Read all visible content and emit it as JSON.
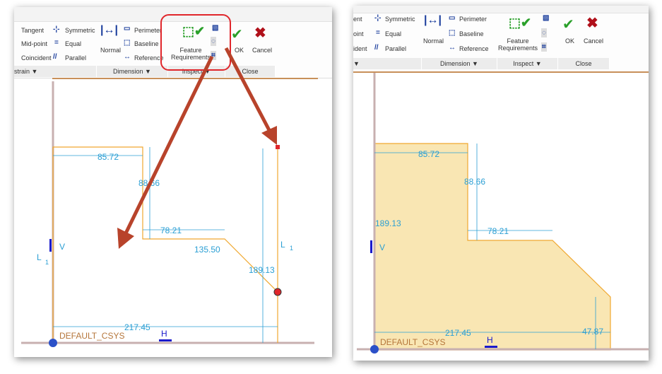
{
  "ribbon": {
    "constrain": {
      "tangent": "Tangent",
      "midpoint": "Mid-point",
      "coincident": "Coincident",
      "symmetric": "Symmetric",
      "equal": "Equal",
      "parallel": "Parallel",
      "group": "strain ▼"
    },
    "dimension": {
      "normal": "Normal",
      "perimeter": "Perimeter",
      "baseline": "Baseline",
      "reference": "Reference",
      "group": "Dimension ▼"
    },
    "inspect": {
      "feature_req_1": "Feature",
      "feature_req_2": "Requirements",
      "group": "Inspect ▼"
    },
    "close": {
      "ok": "OK",
      "cancel": "Cancel",
      "group": "Close"
    },
    "right_partial": {
      "tangent": "ent",
      "midpoint": "oint",
      "coincident": "ident",
      "group": "▼"
    }
  },
  "left_sketch": {
    "dims": [
      "85.72",
      "88.66",
      "78.21",
      "135.50",
      "189.13",
      "217.45"
    ],
    "csys": "DEFAULT_CSYS",
    "labels": {
      "l1": "L",
      "l1sub": "1",
      "l2": "L",
      "l2sub": "1",
      "v": "V",
      "h": "H"
    }
  },
  "right_sketch": {
    "dims": [
      "85.72",
      "88.66",
      "78.21",
      "189.13",
      "217.45",
      "47.87"
    ],
    "csys": "DEFAULT_CSYS",
    "fill": "#f9e6b3"
  },
  "colors": {
    "dim": "#2b9fd4",
    "outline": "#f0a830",
    "arrow": "#b8432b",
    "highlight": "#e0262b"
  }
}
